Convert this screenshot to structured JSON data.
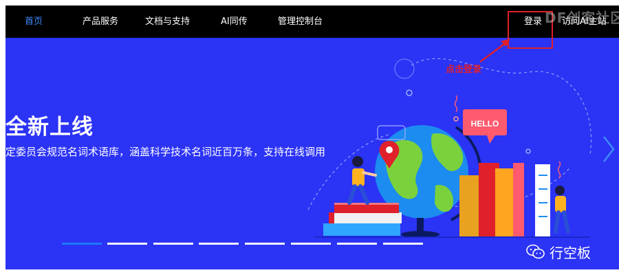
{
  "nav": {
    "items": [
      {
        "label": "首页",
        "active": true
      },
      {
        "label": "产品服务"
      },
      {
        "label": "文档与支持"
      },
      {
        "label": "AI同传"
      },
      {
        "label": "管理控制台"
      }
    ],
    "login": "登录",
    "visit_site": "访问AI主站"
  },
  "hero": {
    "title": "全新上线",
    "subtitle": "定委员会规范名词术语库，涵盖科学技术名词近百万条，支持在线调用",
    "bubble_text": "HELLO"
  },
  "carousel": {
    "slide_count": 8,
    "active_index": 0
  },
  "annotation": {
    "text": "点击登录"
  },
  "watermark": {
    "top": "DF创客社区",
    "bottom": "行空板"
  },
  "colors": {
    "nav_bg": "#000000",
    "nav_active": "#3f8cff",
    "hero_bg": "#2b33f5",
    "annotation": "#e0202a",
    "carousel_active": "#1e7bff"
  }
}
